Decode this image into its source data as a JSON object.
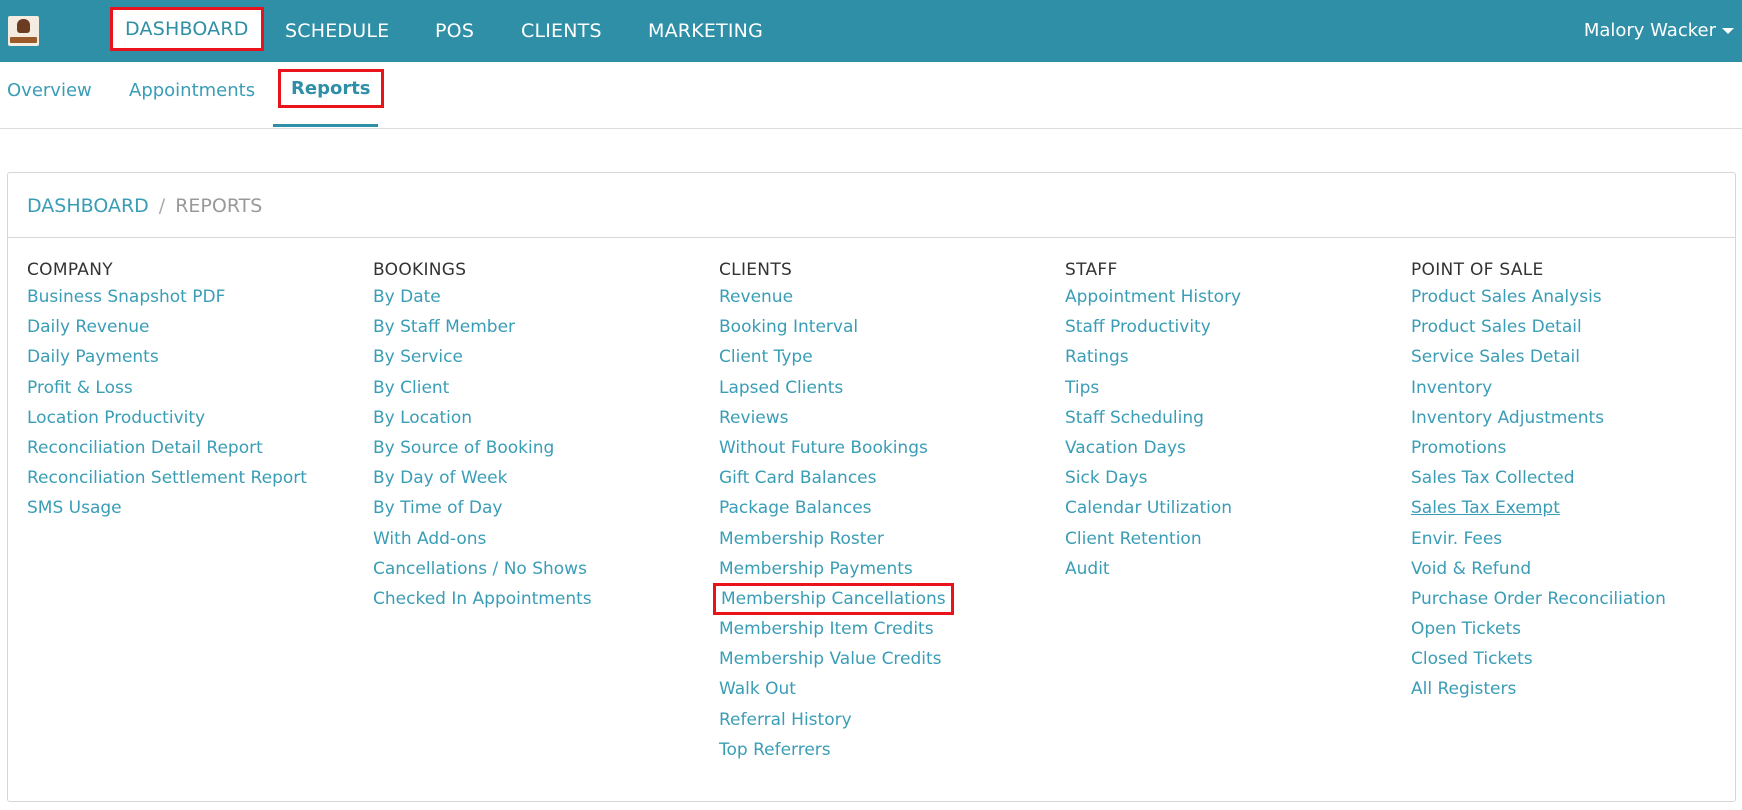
{
  "topnav": {
    "items": [
      "DASHBOARD",
      "SCHEDULE",
      "POS",
      "CLIENTS",
      "MARKETING"
    ],
    "user": "Malory Wacker"
  },
  "subnav": {
    "tabs": [
      "Overview",
      "Appointments",
      "Reports"
    ]
  },
  "breadcrumb": {
    "root": "DASHBOARD",
    "separator": "/",
    "current": "REPORTS"
  },
  "columns": [
    {
      "title": "COMPANY",
      "links": [
        "Business Snapshot PDF",
        "Daily Revenue",
        "Daily Payments",
        "Profit & Loss",
        "Location Productivity",
        "Reconciliation Detail Report",
        "Reconciliation Settlement Report",
        "SMS Usage"
      ]
    },
    {
      "title": "BOOKINGS",
      "links": [
        "By Date",
        "By Staff Member",
        "By Service",
        "By Client",
        "By Location",
        "By Source of Booking",
        "By Day of Week",
        "By Time of Day",
        "With Add-ons",
        "Cancellations / No Shows",
        "Checked In Appointments"
      ]
    },
    {
      "title": "CLIENTS",
      "links": [
        "Revenue",
        "Booking Interval",
        "Client Type",
        "Lapsed Clients",
        "Reviews",
        "Without Future Bookings",
        "Gift Card Balances",
        "Package Balances",
        "Membership Roster",
        "Membership Payments",
        "Membership Cancellations",
        "Membership Item Credits",
        "Membership Value Credits",
        "Walk Out",
        "Referral History",
        "Top Referrers"
      ]
    },
    {
      "title": "STAFF",
      "links": [
        "Appointment History",
        "Staff Productivity",
        "Ratings",
        "Tips",
        "Staff Scheduling",
        "Vacation Days",
        "Sick Days",
        "Calendar Utilization",
        "Client Retention",
        "Audit"
      ]
    },
    {
      "title": "POINT OF SALE",
      "links": [
        "Product Sales Analysis",
        "Product Sales Detail",
        "Service Sales Detail",
        "Inventory",
        "Inventory Adjustments",
        "Promotions",
        "Sales Tax Collected",
        "Sales Tax Exempt",
        "Envir. Fees",
        "Void & Refund",
        "Purchase Order Reconciliation",
        "Open Tickets",
        "Closed Tickets",
        "All Registers"
      ]
    }
  ]
}
